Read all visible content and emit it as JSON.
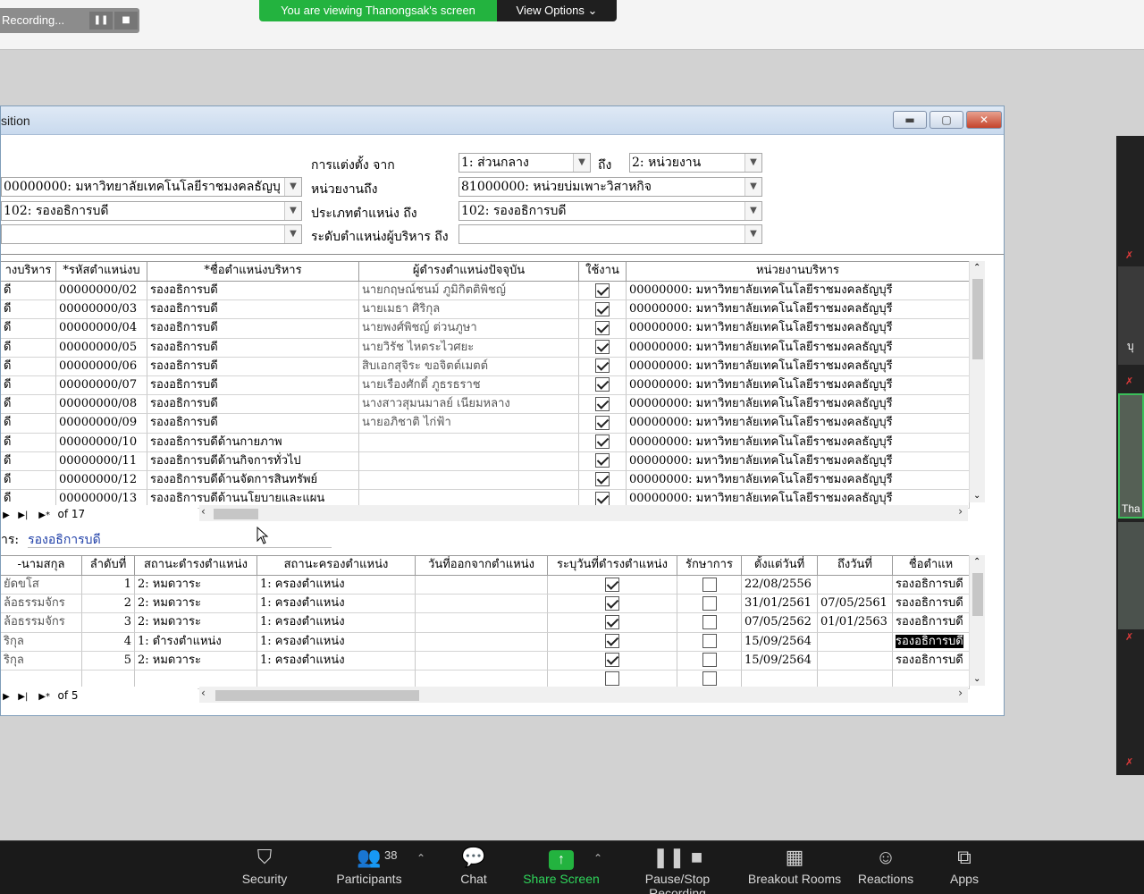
{
  "zoom": {
    "recording_label": "Recording...",
    "viewing_banner": "You are viewing Thanongsak's screen",
    "view_options": "View Options",
    "toolbar": [
      {
        "label": "Security",
        "icon": "shield-icon"
      },
      {
        "label": "Participants",
        "icon": "participants-icon",
        "count": "38"
      },
      {
        "label": "Chat",
        "icon": "chat-icon"
      },
      {
        "label": "Share Screen",
        "icon": "share-screen-icon"
      },
      {
        "label": "Pause/Stop Recording",
        "icon": "pause-stop-recording-icon"
      },
      {
        "label": "Breakout Rooms",
        "icon": "breakout-rooms-icon"
      },
      {
        "label": "Reactions",
        "icon": "reactions-icon"
      },
      {
        "label": "Apps",
        "icon": "apps-icon"
      }
    ],
    "participant_name_fragment": "Tha",
    "participant_name_fragment2": "บุ"
  },
  "window": {
    "title": "sition",
    "filters": {
      "appoint_from_label": "การแต่งตั้ง จาก",
      "appoint_from_value": "1: ส่วนกลาง",
      "to_label": "ถึง",
      "appoint_to_value": "2: หน่วยงาน",
      "org_from_value": "00000000: มหาวิทยาลัยเทคโนโลยีราชมงคลธัญบุ",
      "org_to_label": "หน่วยงานถึง",
      "org_to_value": "81000000: หน่วยบ่มเพาะวิสาหกิจ",
      "postype_from_value": "102: รองอธิการบดี",
      "postype_to_label": "ประเภทตำแหน่ง ถึง",
      "postype_to_value": "102: รองอธิการบดี",
      "level_from_value": "",
      "level_to_label": "ระดับตำแหน่งผู้บริหาร ถึง",
      "level_to_value": ""
    },
    "grid1": {
      "headers": [
        "างบริหาร",
        "*รหัสตำแหน่งบ",
        "*ชื่อตำแหน่งบริหาร",
        "ผู้ดำรงตำแหน่งปัจจุบัน",
        "ใช้งาน",
        "หน่วยงานบริหาร"
      ],
      "rows": [
        {
          "c0": "ดี",
          "code": "00000000/02",
          "name": "รองอธิการบดี",
          "holder": "นายกฤษณ์ชนม์ ภูมิกิตติพิชญ์",
          "active": true,
          "org": "00000000: มหาวิทยาลัยเทคโนโลยีราชมงคลธัญบุรี"
        },
        {
          "c0": "ดี",
          "code": "00000000/03",
          "name": "รองอธิการบดี",
          "holder": "นายเมธา ศิริกุล",
          "active": true,
          "org": "00000000: มหาวิทยาลัยเทคโนโลยีราชมงคลธัญบุรี"
        },
        {
          "c0": "ดี",
          "code": "00000000/04",
          "name": "รองอธิการบดี",
          "holder": "นายพงศ์พิชญ์ ต่วนภูษา",
          "active": true,
          "org": "00000000: มหาวิทยาลัยเทคโนโลยีราชมงคลธัญบุรี"
        },
        {
          "c0": "ดี",
          "code": "00000000/05",
          "name": "รองอธิการบดี",
          "holder": "นายวิรัช ไหตระไวศยะ",
          "active": true,
          "org": "00000000: มหาวิทยาลัยเทคโนโลยีราชมงคลธัญบุรี"
        },
        {
          "c0": "ดี",
          "code": "00000000/06",
          "name": "รองอธิการบดี",
          "holder": "สิบเอกสุจิระ ขอจิตต์เมตต์",
          "active": true,
          "org": "00000000: มหาวิทยาลัยเทคโนโลยีราชมงคลธัญบุรี"
        },
        {
          "c0": "ดี",
          "code": "00000000/07",
          "name": "รองอธิการบดี",
          "holder": "นายเรืองศักดิ์ ภูธรธราช",
          "active": true,
          "org": "00000000: มหาวิทยาลัยเทคโนโลยีราชมงคลธัญบุรี"
        },
        {
          "c0": "ดี",
          "code": "00000000/08",
          "name": "รองอธิการบดี",
          "holder": "นางสาวสุมนมาลย์ เนียมหลาง",
          "active": true,
          "org": "00000000: มหาวิทยาลัยเทคโนโลยีราชมงคลธัญบุรี"
        },
        {
          "c0": "ดี",
          "code": "00000000/09",
          "name": "รองอธิการบดี",
          "holder": "นายอภิชาติ ไก่ฟ้า",
          "active": true,
          "org": "00000000: มหาวิทยาลัยเทคโนโลยีราชมงคลธัญบุรี"
        },
        {
          "c0": "ดี",
          "code": "00000000/10",
          "name": "รองอธิการบดีด้านกายภาพ",
          "holder": "",
          "active": true,
          "org": "00000000: มหาวิทยาลัยเทคโนโลยีราชมงคลธัญบุรี"
        },
        {
          "c0": "ดี",
          "code": "00000000/11",
          "name": "รองอธิการบดีด้านกิจการทั่วไป",
          "holder": "",
          "active": true,
          "org": "00000000: มหาวิทยาลัยเทคโนโลยีราชมงคลธัญบุรี"
        },
        {
          "c0": "ดี",
          "code": "00000000/12",
          "name": "รองอธิการบดีด้านจัดการสินทรัพย์",
          "holder": "",
          "active": true,
          "org": "00000000: มหาวิทยาลัยเทคโนโลยีราชมงคลธัญบุรี"
        },
        {
          "c0": "ดี",
          "code": "00000000/13",
          "name": "รองอธิการบดีด้านนโยบายและแผน",
          "holder": "",
          "active": true,
          "org": "00000000: มหาวิทยาลัยเทคโนโลยีราชมงคลธัญบุรี"
        }
      ],
      "record_of": "of 17"
    },
    "current_position": {
      "label": "าร:",
      "value": "รองอธิการบดี"
    },
    "grid2": {
      "headers": [
        "-นามสกุล",
        "ลำดับที่",
        "สถานะดำรงตำแหน่ง",
        "สถานะครองตำแหน่ง",
        "วันที่ออกจากตำแหน่ง",
        "ระบุวันที่ดำรงตำแหน่ง",
        "รักษาการ",
        "ตั้งแต่วันที่",
        "ถึงวันที่",
        "ชื่อตำแห"
      ],
      "rows": [
        {
          "name": "ยัดขโส",
          "seq": "1",
          "hold": "2: หมดวาระ",
          "occupy": "1: ครองตำแหน่ง",
          "left": "",
          "spec": true,
          "acting": false,
          "from": "22/08/2556",
          "to": "",
          "pos": "รองอธิการบดี",
          "selected": false
        },
        {
          "name": "ล้อธรรมจักร",
          "seq": "2",
          "hold": "2: หมดวาระ",
          "occupy": "1: ครองตำแหน่ง",
          "left": "",
          "spec": true,
          "acting": false,
          "from": "31/01/2561",
          "to": "07/05/2561",
          "pos": "รองอธิการบดี",
          "selected": false
        },
        {
          "name": "ล้อธรรมจักร",
          "seq": "3",
          "hold": "2: หมดวาระ",
          "occupy": "1: ครองตำแหน่ง",
          "left": "",
          "spec": true,
          "acting": false,
          "from": "07/05/2562",
          "to": "01/01/2563",
          "pos": "รองอธิการบดี",
          "selected": false
        },
        {
          "name": "ริกุล",
          "seq": "4",
          "hold": "1: ดำรงตำแหน่ง",
          "occupy": "1: ครองตำแหน่ง",
          "left": "",
          "spec": true,
          "acting": false,
          "from": "15/09/2564",
          "to": "",
          "pos": "รองอธิการบดี",
          "selected": true
        },
        {
          "name": "ริกุล",
          "seq": "5",
          "hold": "2: หมดวาระ",
          "occupy": "1: ครองตำแหน่ง",
          "left": "",
          "spec": true,
          "acting": false,
          "from": "15/09/2564",
          "to": "",
          "pos": "รองอธิการบดี",
          "selected": false
        }
      ],
      "record_of": "of 5"
    }
  }
}
